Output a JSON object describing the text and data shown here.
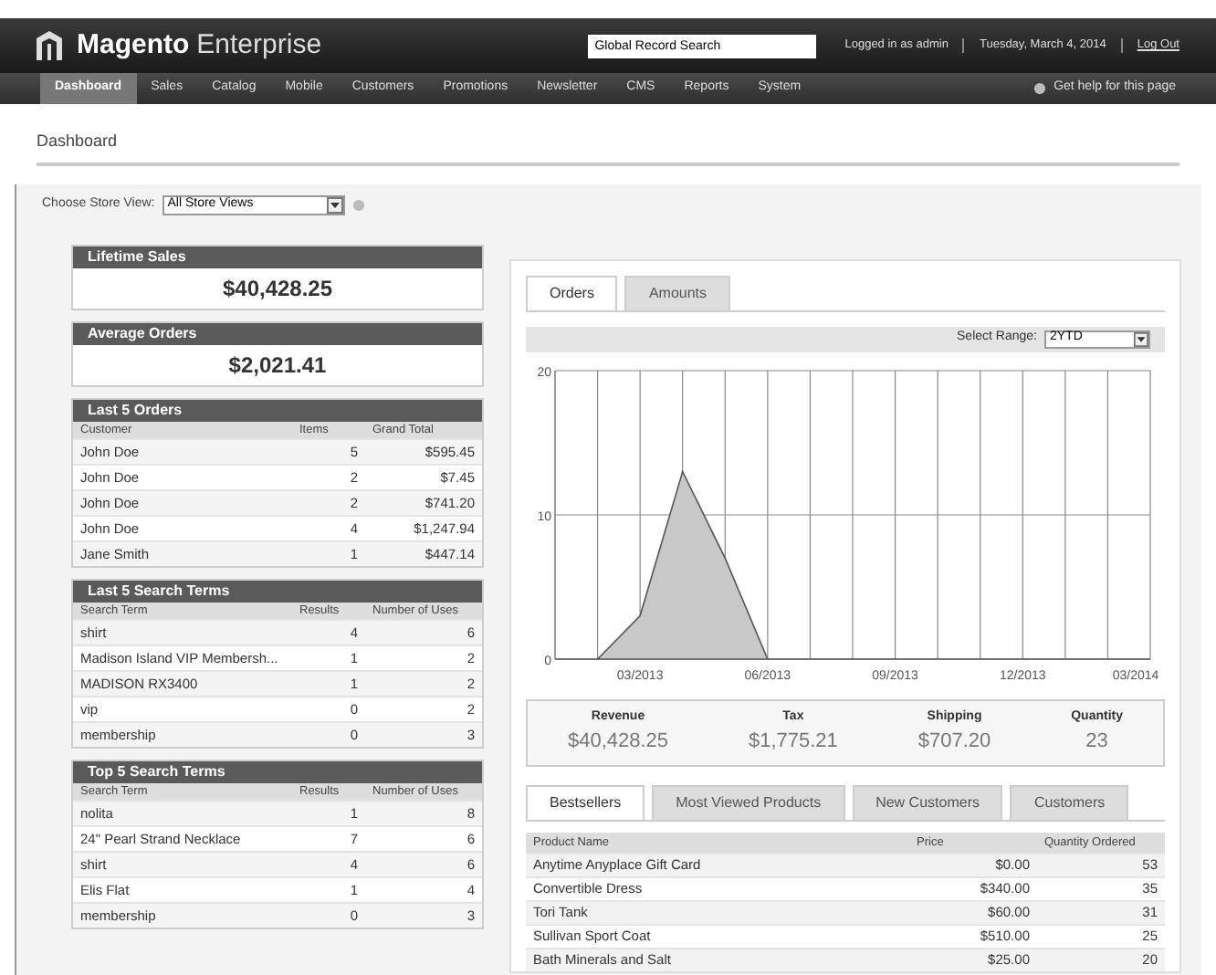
{
  "header": {
    "logo": "Magento",
    "logo_suffix": "Enterprise",
    "search": {
      "placeholder": "Global Record Search"
    },
    "user": "Logged in as admin",
    "date": "Tuesday, March 4, 2014",
    "logout": "Log Out"
  },
  "nav": {
    "items": [
      {
        "label": "Dashboard",
        "selected": true
      },
      {
        "label": "Sales",
        "selected": false
      },
      {
        "label": "Catalog",
        "selected": false
      },
      {
        "label": "Mobile",
        "selected": false
      },
      {
        "label": "Customers",
        "selected": false
      },
      {
        "label": "Promotions",
        "selected": false
      },
      {
        "label": "Newsletter",
        "selected": false
      },
      {
        "label": "CMS",
        "selected": false
      },
      {
        "label": "Reports",
        "selected": false
      },
      {
        "label": "System",
        "selected": false
      }
    ],
    "help": "Get help for this page"
  },
  "page_title": "Dashboard",
  "store_view": {
    "label": "Choose Store View:",
    "value": "All Store Views"
  },
  "stats": [
    {
      "title": "Lifetime Sales",
      "value": "$40,428.25"
    },
    {
      "title": "Average Orders",
      "value": "$2,021.41"
    }
  ],
  "tables": [
    {
      "title": "Last 5 Orders",
      "columns": [
        "Customer",
        "Items",
        "Grand Total"
      ],
      "rows": [
        [
          "John Doe",
          "5",
          "$595.45"
        ],
        [
          "John Doe",
          "2",
          "$7.45"
        ],
        [
          "John Doe",
          "2",
          "$741.20"
        ],
        [
          "John Doe",
          "4",
          "$1,247.94"
        ],
        [
          "Jane Smith",
          "1",
          "$447.14"
        ]
      ]
    },
    {
      "title": "Last 5 Search Terms",
      "columns": [
        "Search Term",
        "Results",
        "Number of Uses"
      ],
      "rows": [
        [
          "shirt",
          "4",
          "6"
        ],
        [
          "Madison Island VIP Membersh...",
          "1",
          "2"
        ],
        [
          "MADISON RX3400",
          "1",
          "2"
        ],
        [
          "vip",
          "0",
          "2"
        ],
        [
          "membership",
          "0",
          "3"
        ]
      ]
    },
    {
      "title": "Top 5 Search Terms",
      "columns": [
        "Search Term",
        "Results",
        "Number of Uses"
      ],
      "rows": [
        [
          "nolita",
          "1",
          "8"
        ],
        [
          "24\" Pearl Strand Necklace",
          "7",
          "6"
        ],
        [
          "shirt",
          "4",
          "6"
        ],
        [
          "Elis Flat",
          "1",
          "4"
        ],
        [
          "membership",
          "0",
          "3"
        ]
      ]
    }
  ],
  "chart_tabs": [
    {
      "label": "Orders",
      "selected": true
    },
    {
      "label": "Amounts",
      "selected": false
    }
  ],
  "range": {
    "label": "Select Range:",
    "value": "2YTD"
  },
  "chart_data": {
    "type": "area",
    "categories": [
      null,
      null,
      "03/2013",
      null,
      null,
      "06/2013",
      null,
      null,
      "09/2013",
      null,
      null,
      "12/2013",
      null,
      null,
      "03/2014"
    ],
    "series": [
      {
        "color": "#c8c8c8",
        "values": [
          0,
          0,
          3,
          13,
          7,
          0,
          0,
          0,
          0,
          0,
          0,
          0,
          0,
          0,
          0
        ]
      }
    ],
    "ylim": [
      0,
      20
    ],
    "yticks": [
      0,
      10,
      20
    ],
    "grid": true
  },
  "totals": [
    {
      "label": "Revenue",
      "value": "$40,428.25"
    },
    {
      "label": "Tax",
      "value": "$1,775.21"
    },
    {
      "label": "Shipping",
      "value": "$707.20"
    },
    {
      "label": "Quantity",
      "value": "23"
    }
  ],
  "grid_tabs": [
    {
      "label": "Bestsellers",
      "selected": true
    },
    {
      "label": "Most Viewed Products",
      "selected": false
    },
    {
      "label": "New Customers",
      "selected": false
    },
    {
      "label": "Customers",
      "selected": false
    }
  ],
  "grid": {
    "columns": [
      "Product Name",
      "Price",
      "Quantity Ordered"
    ],
    "rows": [
      [
        "Anytime Anyplace Gift Card",
        "$0.00",
        "53"
      ],
      [
        "Convertible Dress",
        "$340.00",
        "35"
      ],
      [
        "Tori Tank",
        "$60.00",
        "31"
      ],
      [
        "Sullivan Sport Coat",
        "$510.00",
        "25"
      ],
      [
        "Bath Minerals and Salt",
        "$25.00",
        "20"
      ]
    ]
  }
}
